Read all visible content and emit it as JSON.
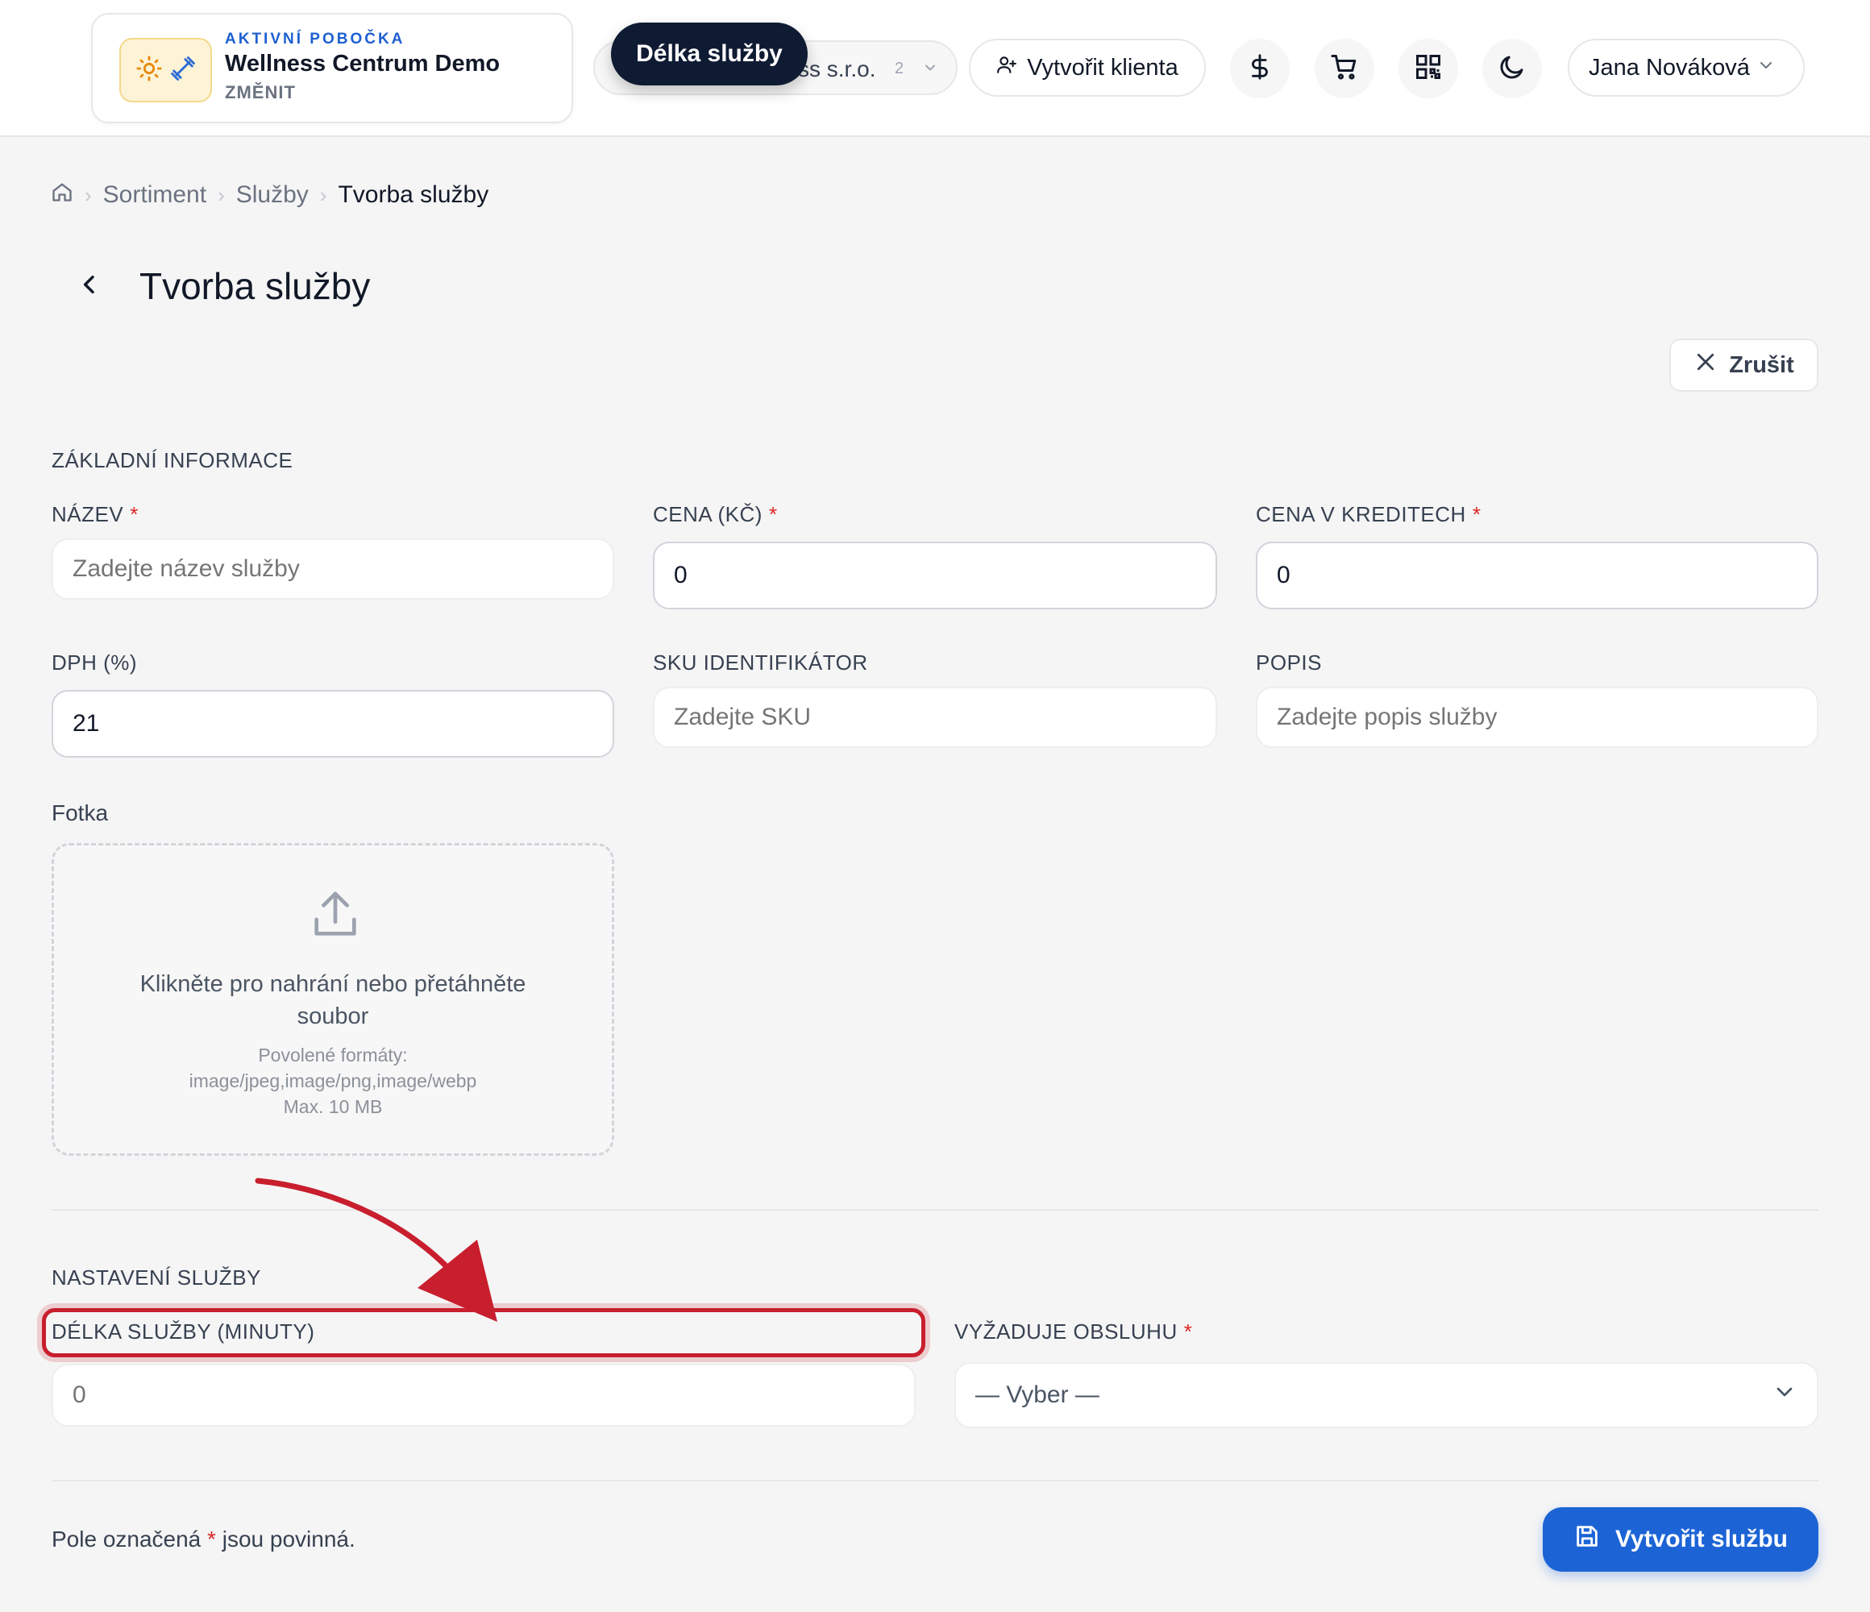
{
  "header": {
    "branch": {
      "eyebrow": "AKTIVNÍ POBOČKA",
      "name": "Wellness Centrum Demo",
      "change": "ZMĚNIT"
    },
    "company_select": {
      "visible_text": "ss s.r.o.",
      "count": "2"
    },
    "tooltip": "Délka služby",
    "create_client": "Vytvořit klienta",
    "user_name": "Jana Nováková"
  },
  "breadcrumb": {
    "items": [
      "Sortiment",
      "Služby"
    ],
    "current": "Tvorba služby"
  },
  "page": {
    "title": "Tvorba služby",
    "cancel": "Zrušit"
  },
  "basic": {
    "section": "ZÁKLADNÍ INFORMACE",
    "name_label": "NÁZEV",
    "name_placeholder": "Zadejte název služby",
    "price_label": "CENA (KČ)",
    "price_value": "0",
    "credits_label": "CENA V KREDITECH",
    "credits_value": "0",
    "vat_label": "DPH (%)",
    "vat_value": "21",
    "sku_label": "SKU IDENTIFIKÁTOR",
    "sku_placeholder": "Zadejte SKU",
    "desc_label": "POPIS",
    "desc_placeholder": "Zadejte popis služby",
    "photo_label": "Fotka",
    "upload_line1": "Klikněte pro nahrání nebo přetáhněte",
    "upload_line2": "soubor",
    "upload_formats_label": "Povolené formáty:",
    "upload_formats": "image/jpeg,image/png,image/webp",
    "upload_max": "Max. 10 MB"
  },
  "settings": {
    "section": "NASTAVENÍ SLUŽBY",
    "duration_label": "DÉLKA SLUŽBY (MINUTY)",
    "duration_value": "0",
    "staff_label": "VYŽADUJE OBSLUHU",
    "staff_selected": "— Vyber —"
  },
  "footer": {
    "note_prefix": "Pole označená",
    "note_star": "*",
    "note_suffix": "jsou povinná.",
    "submit": "Vytvořit službu"
  },
  "required_mark": "*",
  "colors": {
    "accent": "#1c64d6",
    "required": "#dc2626",
    "annotation": "#c81e2d",
    "tooltip_bg": "#0f1b33"
  },
  "icons": [
    "sun-icon",
    "dumbbell-icon",
    "chevron-down-icon",
    "user-plus-icon",
    "dollar-icon",
    "cart-icon",
    "qr-code-icon",
    "moon-icon",
    "home-icon",
    "chevron-left-icon",
    "close-icon",
    "upload-icon",
    "save-icon"
  ]
}
